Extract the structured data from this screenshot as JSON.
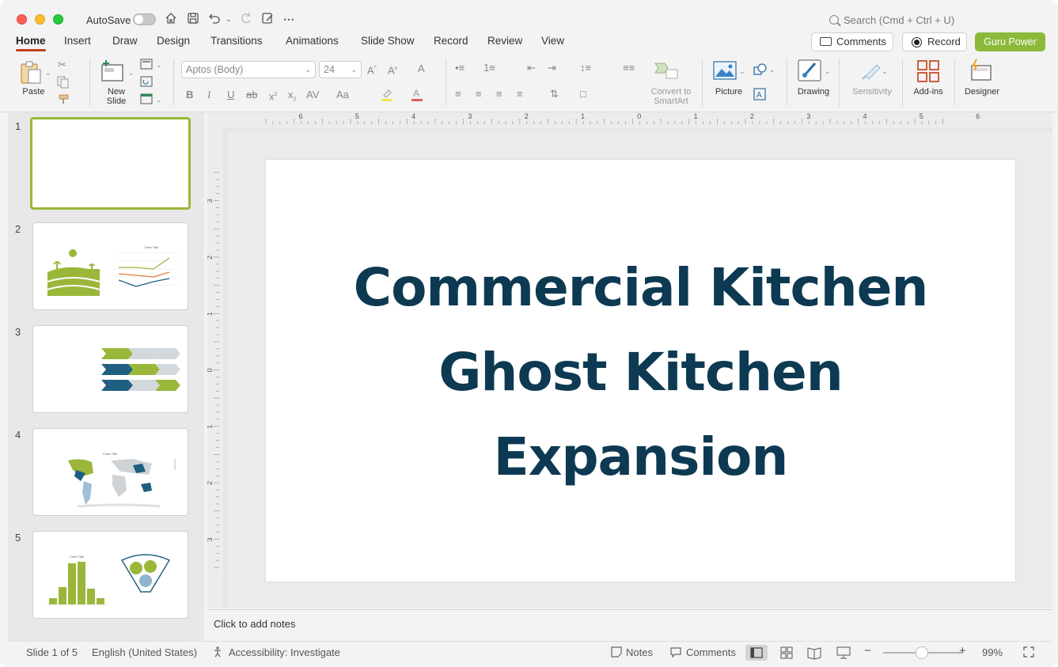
{
  "titlebar": {
    "autosave_label": "AutoSave",
    "search_placeholder": "Search (Cmd + Ctrl + U)"
  },
  "tabs": [
    {
      "label": "Home",
      "active": true
    },
    {
      "label": "Insert"
    },
    {
      "label": "Draw"
    },
    {
      "label": "Design"
    },
    {
      "label": "Transitions"
    },
    {
      "label": "Animations"
    },
    {
      "label": "Slide Show"
    },
    {
      "label": "Record"
    },
    {
      "label": "Review"
    },
    {
      "label": "View"
    }
  ],
  "actions": {
    "comments_label": "Comments",
    "record_label": "Record",
    "guru_label": "Guru Power"
  },
  "ribbon": {
    "paste_label": "Paste",
    "new_slide_label": "New\nSlide",
    "font_name": "Aptos (Body)",
    "font_size": "24",
    "convert_label": "Convert to\nSmartArt",
    "picture_label": "Picture",
    "drawing_label": "Drawing",
    "sensitivity_label": "Sensitivity",
    "addins_label": "Add-ins",
    "designer_label": "Designer"
  },
  "ruler": {
    "top_ticks": [
      "6",
      "5",
      "4",
      "3",
      "2",
      "1",
      "0",
      "1",
      "2",
      "3",
      "4",
      "5",
      "6"
    ],
    "left_ticks": [
      "3",
      "2",
      "1",
      "0",
      "1",
      "2",
      "3"
    ]
  },
  "slides": [
    {
      "number": "1",
      "selected": true
    },
    {
      "number": "2",
      "thumb_chart_title": "Chart Title"
    },
    {
      "number": "3"
    },
    {
      "number": "4",
      "thumb_chart_title": "Chart Title"
    },
    {
      "number": "5",
      "thumb_chart_title": "Chart Title"
    }
  ],
  "current_slide": {
    "title_lines": [
      "Commercial Kitchen",
      "Ghost Kitchen",
      "Expansion"
    ],
    "title_color": "#0d3a52"
  },
  "notes_placeholder": "Click to add notes",
  "status": {
    "slide_info": "Slide 1 of 5",
    "language": "English (United States)",
    "accessibility": "Accessibility: Investigate",
    "notes_label": "Notes",
    "comments_label": "Comments",
    "zoom": "99%"
  },
  "colors": {
    "accent_green": "#8cb93a",
    "navy": "#0d3a52",
    "teal": "#1f5f82"
  }
}
